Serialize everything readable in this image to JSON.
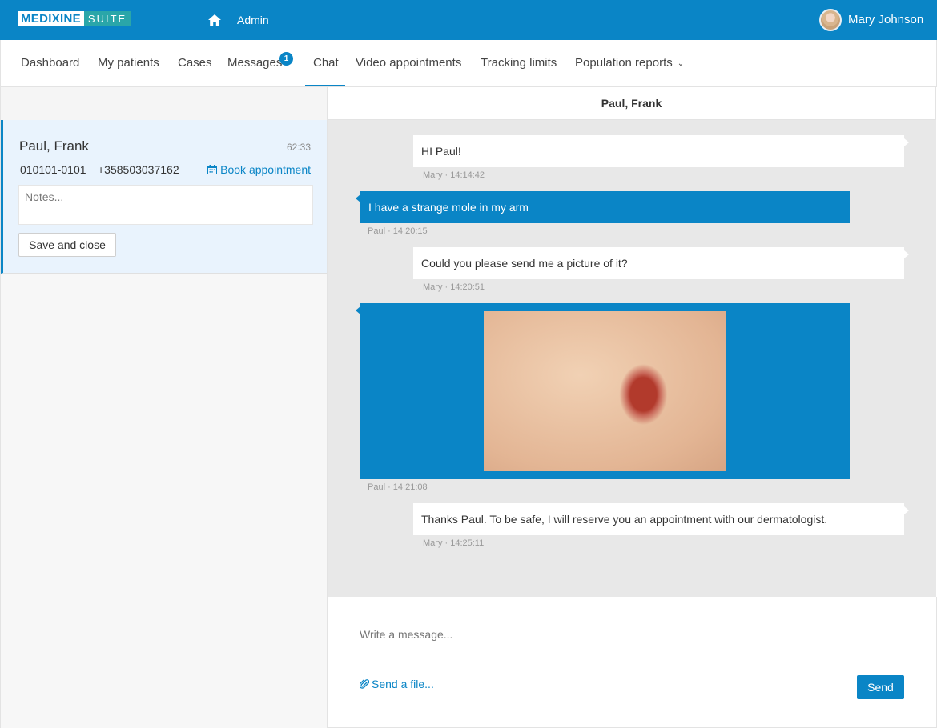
{
  "brand": {
    "name_main": "MEDIXINE",
    "name_suite": "SUITE"
  },
  "topbar": {
    "admin_label": "Admin",
    "user_name": "Mary Johnson",
    "home_icon": "home-icon",
    "avatar_icon": "user-avatar"
  },
  "nav": {
    "items": [
      {
        "label": "Dashboard"
      },
      {
        "label": "My patients"
      },
      {
        "label": "Cases"
      },
      {
        "label": "Messages"
      },
      {
        "label": "Chat"
      },
      {
        "label": "Video appointments"
      },
      {
        "label": "Tracking limits"
      },
      {
        "label": "Population reports"
      }
    ],
    "active": "Chat",
    "messages_badge": "1"
  },
  "patient": {
    "name": "Paul, Frank",
    "time": "62:33",
    "id": "010101-0101",
    "phone": "+358503037162",
    "book_label": "Book appointment",
    "notes_placeholder": "Notes...",
    "save_label": "Save and close"
  },
  "chat": {
    "header": "Paul, Frank",
    "messages": [
      {
        "sender": "Mary",
        "text": "HI Paul!",
        "meta": "Mary · 14:14:42"
      },
      {
        "sender": "Paul",
        "text": "I have a strange mole in my arm",
        "meta": "Paul · 14:20:15"
      },
      {
        "sender": "Mary",
        "text": "Could you please send me a picture of it?",
        "meta": "Mary · 14:20:51"
      },
      {
        "sender": "Paul",
        "text": "",
        "meta": "Paul · 14:21:08",
        "attachment": "image"
      },
      {
        "sender": "Mary",
        "text": "Thanks Paul. To be safe, I will reserve you an appointment with our dermatologist.",
        "meta": "Mary · 14:25:11"
      }
    ]
  },
  "composer": {
    "placeholder": "Write a message...",
    "file_label": "Send a file...",
    "send_label": "Send"
  },
  "colors": {
    "primary": "#0a85c6",
    "suite": "#2aa6a9",
    "chat_bg": "#e8e8e8",
    "card_bg": "#e9f3fd"
  }
}
